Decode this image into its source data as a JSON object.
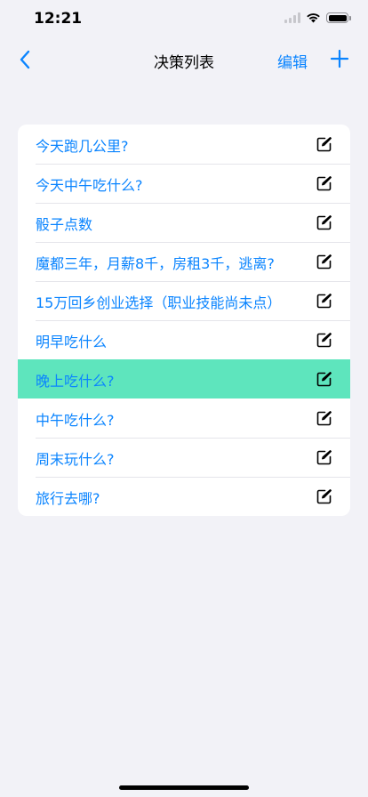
{
  "status_bar": {
    "time": "12:21"
  },
  "nav": {
    "title": "决策列表",
    "edit_label": "编辑"
  },
  "colors": {
    "accent": "#0a84ff",
    "selected_row": "#5ee5bd",
    "background": "#f2f2f7"
  },
  "icons": {
    "back": "chevron-left-icon",
    "add": "plus-icon",
    "row_edit": "square-pencil-icon"
  },
  "decisions": [
    {
      "label": "今天跑几公里?"
    },
    {
      "label": "今天中午吃什么?"
    },
    {
      "label": "骰子点数"
    },
    {
      "label": "魔都三年，月薪8千，房租3千，逃离?"
    },
    {
      "label": "15万回乡创业选择（职业技能尚未点）"
    },
    {
      "label": "明早吃什么"
    },
    {
      "label": "晚上吃什么?",
      "selected": true
    },
    {
      "label": "中午吃什么?"
    },
    {
      "label": "周末玩什么?"
    },
    {
      "label": "旅行去哪?"
    }
  ]
}
